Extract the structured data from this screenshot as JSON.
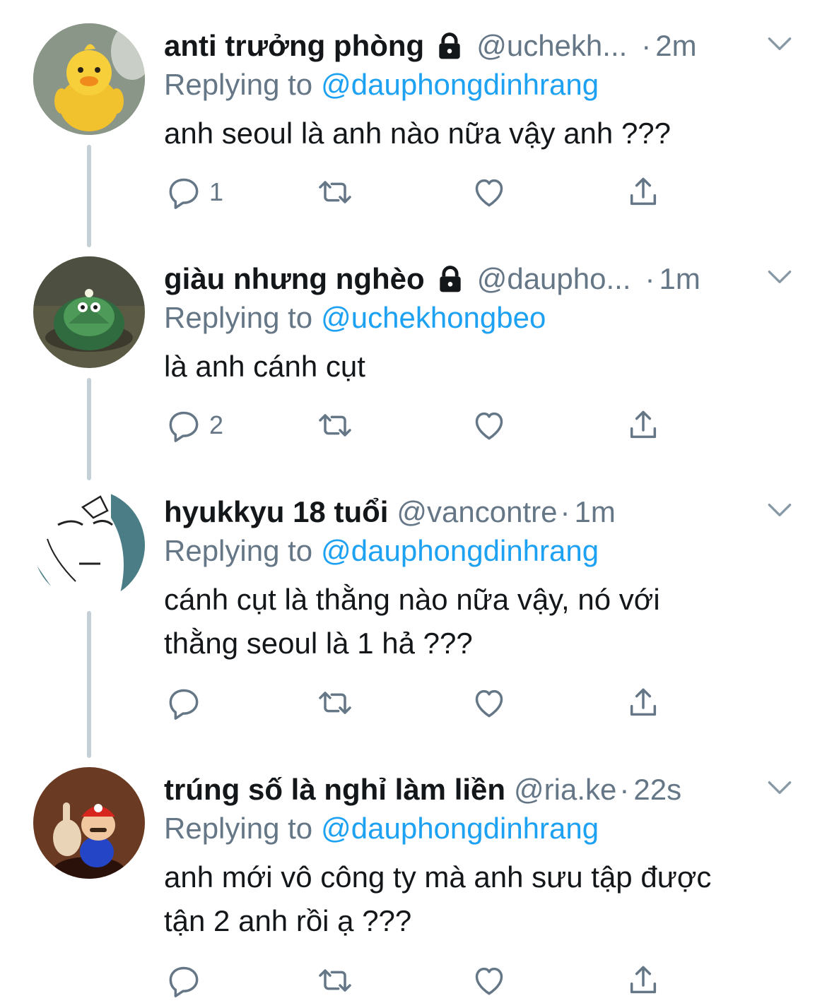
{
  "tweets": [
    {
      "name": "anti trưởng phòng",
      "protected": true,
      "handle": "@uchekh...",
      "dot": "·",
      "time": "2m",
      "replying_label": "Replying to",
      "replying_to": "@dauphongdinhrang",
      "text_lines": [
        "anh seoul là anh nào nữa vậy anh ???"
      ],
      "reply_count": "1",
      "avatar": "yellow-duck-avatar"
    },
    {
      "name": "giàu nhưng nghèo",
      "protected": true,
      "handle": "@daupho...",
      "dot": "·",
      "time": "1m",
      "replying_label": "Replying to",
      "replying_to": "@uchekhongbeo",
      "text_lines": [
        "là anh cánh cụt"
      ],
      "reply_count": "2",
      "avatar": "green-turtle-avatar"
    },
    {
      "name": "hyukkyu 18 tuổi",
      "protected": false,
      "handle": "@vancontre",
      "dot": "·",
      "time": "1m",
      "replying_label": "Replying to",
      "replying_to": "@dauphongdinhrang",
      "text_lines": [
        "cánh cụt là thằng nào nữa vậy, nó với",
        "thằng seoul là 1 hả ???"
      ],
      "reply_count": "",
      "avatar": "sketch-face-avatar"
    },
    {
      "name": "trúng số là nghỉ làm liền",
      "protected": false,
      "handle": "@ria.ke",
      "dot": "·",
      "time": "22s",
      "replying_label": "Replying to",
      "replying_to": "@dauphongdinhrang",
      "text_lines": [
        "anh mới vô công ty mà anh sưu tập được",
        "tận 2 anh rồi ạ ???"
      ],
      "reply_count": "",
      "avatar": "mario-avatar"
    }
  ],
  "icons": {
    "protected": "lock-icon",
    "menu": "chevron-down-icon",
    "reply": "reply-icon",
    "retweet": "retweet-icon",
    "like": "heart-icon",
    "share": "share-icon"
  },
  "colors": {
    "text": "#14171a",
    "secondary": "#657786",
    "link": "#1da1f2",
    "thread_line": "#c4cfd6"
  }
}
